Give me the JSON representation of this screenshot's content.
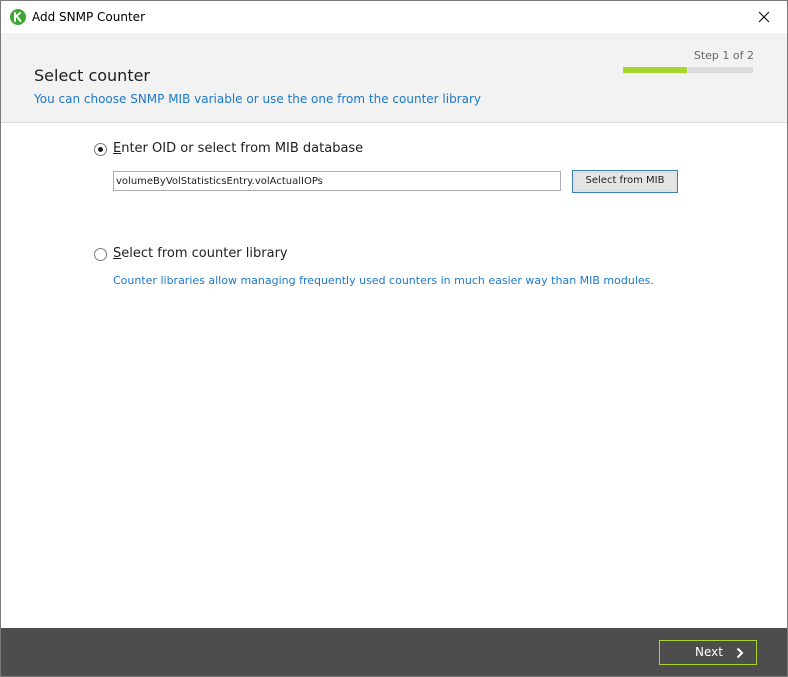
{
  "window": {
    "title": "Add SNMP Counter",
    "icon": "app-logo-icon",
    "close_icon": "close-icon"
  },
  "header": {
    "step_text": "Step 1 of 2",
    "step_progress": {
      "current": 1,
      "total": 2
    },
    "title": "Select counter",
    "subtitle": "You can choose SNMP MIB variable or use the one from the counter library"
  },
  "options": {
    "oid": {
      "label_mnemonic": "E",
      "label_rest": "nter OID or select from MIB database",
      "selected": true,
      "input_value": "volumeByVolStatisticsEntry.volActualIOPs",
      "button_label": "Select from MIB"
    },
    "library": {
      "label_mnemonic": "S",
      "label_rest": "elect from counter library",
      "selected": false,
      "description": "Counter libraries allow managing frequently used counters in much easier way than MIB modules."
    }
  },
  "footer": {
    "next_label": "Next",
    "next_icon": "chevron-right-icon"
  },
  "colors": {
    "accent_green": "#a8d52b",
    "link_blue": "#1e78c8",
    "footer_bg": "#4d4d4d",
    "header_bg": "#f2f2f2"
  }
}
